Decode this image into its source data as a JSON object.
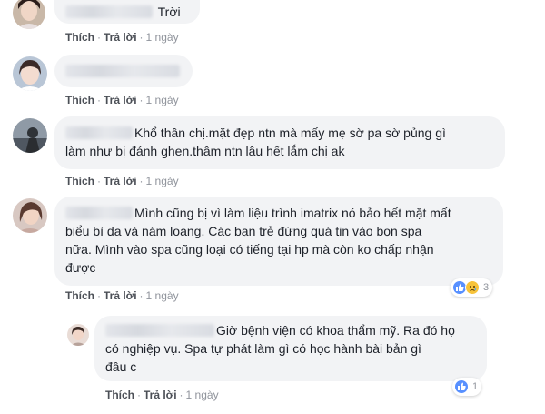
{
  "comments": [
    {
      "text_after_name": "Trời",
      "actions": {
        "like": "Thích",
        "reply": "Trả lời",
        "time": "1 ngày"
      }
    },
    {
      "text_after_name": "",
      "actions": {
        "like": "Thích",
        "reply": "Trả lời",
        "time": "1 ngày"
      }
    },
    {
      "line1": "Khổ thân chị.mặt đẹp ntn mà mấy mẹ sờ pa sờ pủng gì",
      "line2": "làm như bị đánh ghen.thâm ntn lâu hết lắm chị ak",
      "actions": {
        "like": "Thích",
        "reply": "Trả lời",
        "time": "1 ngày"
      }
    },
    {
      "line1": "Mình cũng bị vì làm liệu trình imatrix nó bảo hết mặt mất",
      "line2": "biểu bì da và nám loang. Các bạn trẻ đừng quá tin vào bọn spa",
      "line3": "nữa. Mình vào spa cũng loại có tiếng tại hp mà còn ko chấp nhận",
      "line4": "được",
      "actions": {
        "like": "Thích",
        "reply": "Trả lời",
        "time": "1 ngày"
      },
      "reactions": {
        "icons": [
          "like-reaction-icon",
          "sad-reaction-icon"
        ],
        "count": "3"
      }
    },
    {
      "line1": "Giờ bệnh viện có khoa thẩm mỹ. Ra đó họ",
      "line2": "có nghiệp vụ. Spa tự phát làm gì có học hành bài bản gì",
      "line3": "đâu c",
      "actions": {
        "like": "Thích",
        "reply": "Trả lời",
        "time": "1 ngày"
      },
      "reactions": {
        "icons": [
          "like-reaction-icon"
        ],
        "count": "1"
      }
    }
  ],
  "colors": {
    "bubble": "#f2f3f5",
    "link": "#4b4f56",
    "meta": "#90949c",
    "like_blue": "#5890ff",
    "sad_yellow": "#f7c33a"
  }
}
